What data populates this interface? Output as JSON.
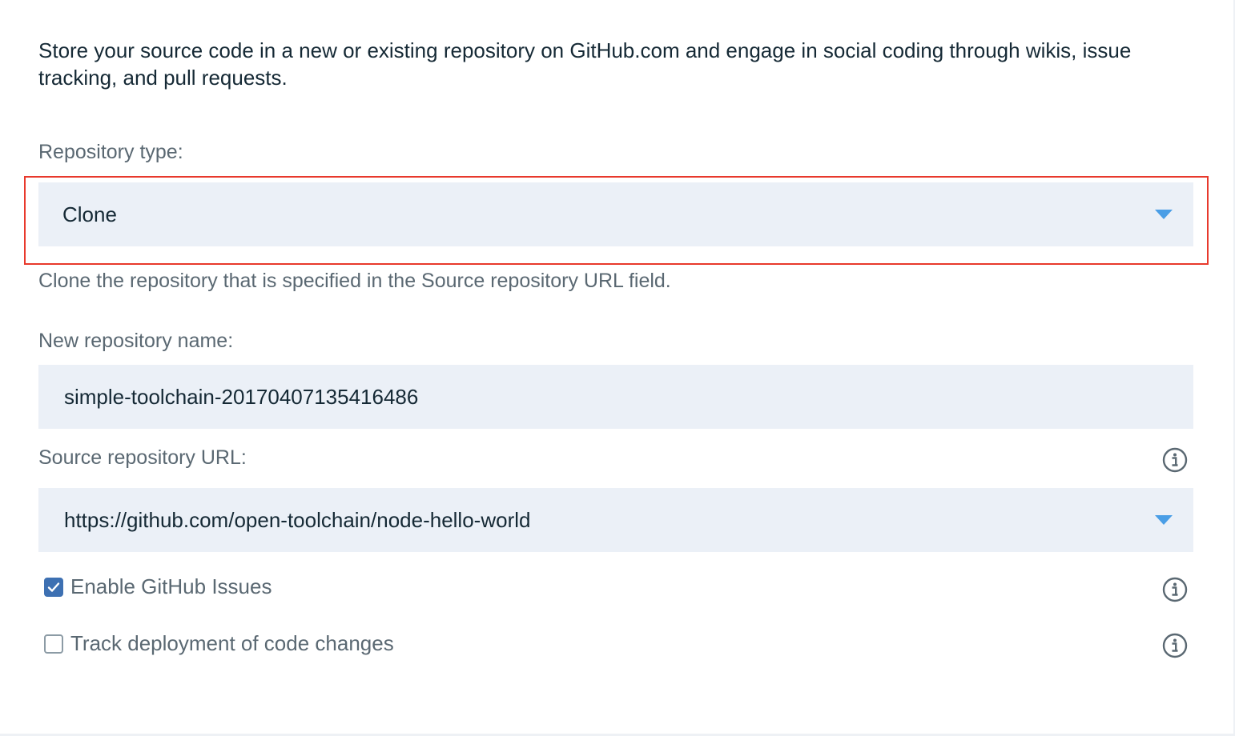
{
  "intro_text": "Store your source code in a new or existing repository on GitHub.com and engage in social coding through wikis, issue tracking, and pull requests.",
  "repository_type": {
    "label": "Repository type:",
    "selected": "Clone",
    "helper": "Clone the repository that is specified in the Source repository URL field."
  },
  "new_repository_name": {
    "label": "New repository name:",
    "value": "simple-toolchain-20170407135416486"
  },
  "source_repository_url": {
    "label": "Source repository URL:",
    "value": "https://github.com/open-toolchain/node-hello-world"
  },
  "options": [
    {
      "label": "Enable GitHub Issues",
      "checked": true
    },
    {
      "label": "Track deployment of code changes",
      "checked": false
    }
  ],
  "colors": {
    "field_bg": "#ebf0f7",
    "caret": "#4a9ee6",
    "highlight_border": "#e8392c",
    "checkbox_checked": "#3d70b2"
  },
  "icons": [
    "chevron-down-icon",
    "info-icon",
    "checkmark-icon"
  ]
}
